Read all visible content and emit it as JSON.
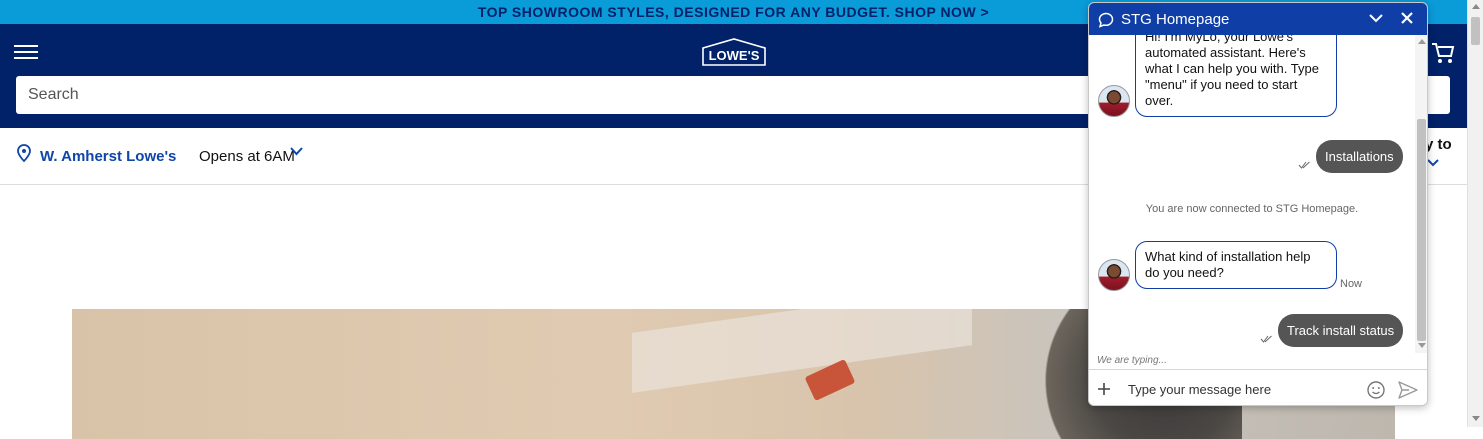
{
  "promo": {
    "text": "TOP SHOWROOM STYLES, DESIGNED FOR ANY BUDGET. SHOP NOW >"
  },
  "header": {
    "menu_icon": "hamburger-menu-icon",
    "logo_text": "LOWE'S",
    "cart_icon": "cart-icon",
    "search_placeholder": "Search"
  },
  "store": {
    "name": "W. Amherst Lowe's",
    "hours": "Opens at 6AM",
    "right_partial": "y to"
  },
  "chat": {
    "title": "STG Homepage",
    "messages": {
      "bot_intro": "Hi! I'm MyLo, your Lowe's automated assistant. Here's what I can help you with. Type \"menu\" if you need to start over.",
      "user_installations": "Installations",
      "system_connected": "You are now connected to STG Homepage.",
      "bot_question": "What kind of installation help do you need?",
      "bot_question_time": "Now",
      "user_track": "Track install status"
    },
    "typing": "We are typing...",
    "input_placeholder": "Type your message here",
    "colors": {
      "header": "#0f3fa6",
      "user_bubble": "#555555",
      "bot_border": "#0f3fa6"
    }
  },
  "colors": {
    "promo_bg": "#0a9bd9",
    "header_bg": "#012169",
    "store_link": "#0f46a8"
  }
}
